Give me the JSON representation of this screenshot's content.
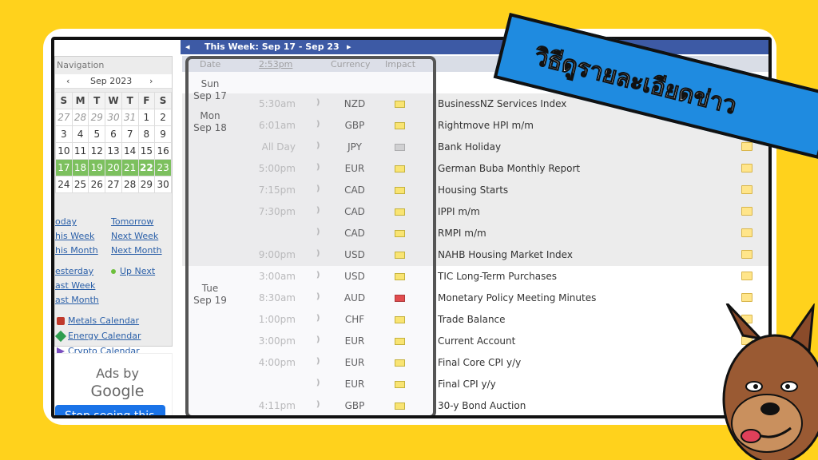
{
  "banner": {
    "text": "วิธีดูรายละเอียดข่าว"
  },
  "topbar": {
    "prev": "◂",
    "week": "This Week: Sep 17 - Sep 23",
    "next": "▸"
  },
  "nav": {
    "title": "Navigation",
    "prev": "‹",
    "month": "Sep 2023",
    "next": "›",
    "weekdays": [
      "S",
      "M",
      "T",
      "W",
      "T",
      "F",
      "S"
    ],
    "weeks": [
      [
        "27",
        "28",
        "29",
        "30",
        "31",
        "1",
        "2"
      ],
      [
        "3",
        "4",
        "5",
        "6",
        "7",
        "8",
        "9"
      ],
      [
        "10",
        "11",
        "12",
        "13",
        "14",
        "15",
        "16"
      ],
      [
        "17",
        "18",
        "19",
        "20",
        "21",
        "22",
        "23"
      ],
      [
        "24",
        "25",
        "26",
        "27",
        "28",
        "29",
        "30"
      ]
    ],
    "links": {
      "today": "oday",
      "tomorrow": "Tomorrow",
      "this_week": "his Week",
      "next_week": "Next Week",
      "this_month": "his Month",
      "next_month": "Next Month",
      "yesterday": "esterday",
      "up_next": "Up Next",
      "last_week": "ast Week",
      "last_month": "ast Month",
      "metals": "Metals Calendar",
      "energy": "Energy Calendar",
      "crypto": "Crypto Calendar"
    }
  },
  "ad": {
    "ads_by": "Ads by",
    "google": "Google",
    "stop": "Stop seeing this"
  },
  "table": {
    "headers": {
      "date": "Date",
      "time": "2:53pm",
      "currency": "Currency",
      "impact": "Impact"
    },
    "dates": [
      {
        "day": "Sun",
        "date": "Sep 17"
      },
      {
        "day": "Mon",
        "date": "Sep 18"
      },
      {
        "day": "Tue",
        "date": "Sep 19"
      }
    ],
    "rows": [
      {
        "time": "5:30am",
        "cur": "NZD",
        "impact": "yellow",
        "event": "BusinessNZ Services Index"
      },
      {
        "time": "6:01am",
        "cur": "GBP",
        "impact": "yellow",
        "event": "Rightmove HPI m/m"
      },
      {
        "time": "All Day",
        "cur": "JPY",
        "impact": "grey",
        "event": "Bank Holiday"
      },
      {
        "time": "5:00pm",
        "cur": "EUR",
        "impact": "yellow",
        "event": "German Buba Monthly Report"
      },
      {
        "time": "7:15pm",
        "cur": "CAD",
        "impact": "yellow",
        "event": "Housing Starts"
      },
      {
        "time": "7:30pm",
        "cur": "CAD",
        "impact": "yellow",
        "event": "IPPI m/m"
      },
      {
        "time": "",
        "cur": "CAD",
        "impact": "yellow",
        "event": "RMPI m/m"
      },
      {
        "time": "9:00pm",
        "cur": "USD",
        "impact": "yellow",
        "event": "NAHB Housing Market Index"
      },
      {
        "time": "3:00am",
        "cur": "USD",
        "impact": "yellow",
        "event": "TIC Long-Term Purchases"
      },
      {
        "time": "8:30am",
        "cur": "AUD",
        "impact": "red",
        "event": "Monetary Policy Meeting Minutes"
      },
      {
        "time": "1:00pm",
        "cur": "CHF",
        "impact": "yellow",
        "event": "Trade Balance"
      },
      {
        "time": "3:00pm",
        "cur": "EUR",
        "impact": "yellow",
        "event": "Current Account"
      },
      {
        "time": "4:00pm",
        "cur": "EUR",
        "impact": "yellow",
        "event": "Final Core CPI y/y"
      },
      {
        "time": "",
        "cur": "EUR",
        "impact": "yellow",
        "event": "Final CPI y/y"
      },
      {
        "time": "4:11pm",
        "cur": "GBP",
        "impact": "yellow",
        "event": "30-y Bond Auction"
      }
    ]
  },
  "colors": {
    "yellow": "#ffe34a",
    "red": "#e01818",
    "grey": "#c8c8c8",
    "accent": "#3d5aa5",
    "highlight": "#7cc05e"
  }
}
